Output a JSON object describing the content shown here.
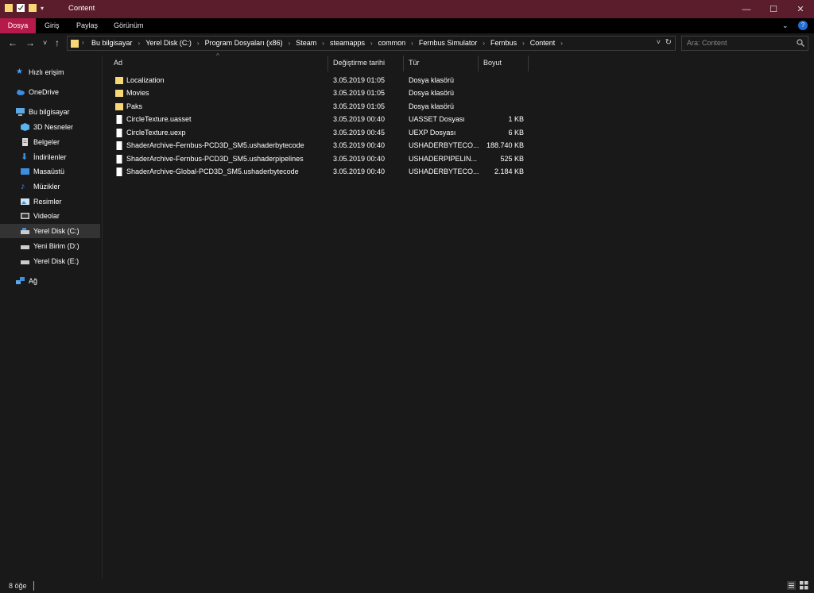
{
  "window": {
    "title": "Content",
    "controls": {
      "minimize": "—",
      "maximize": "☐",
      "close": "✕"
    }
  },
  "ribbon": {
    "tabs": [
      "Dosya",
      "Giriş",
      "Paylaş",
      "Görünüm"
    ],
    "help": "?"
  },
  "nav": {
    "back": "←",
    "forward": "→",
    "recent": "˅",
    "up": "↑",
    "refresh": "↻",
    "dropdown": "˅"
  },
  "breadcrumbs": [
    "Bu bilgisayar",
    "Yerel Disk (C:)",
    "Program Dosyaları (x86)",
    "Steam",
    "steamapps",
    "common",
    "Fernbus Simulator",
    "Fernbus",
    "Content"
  ],
  "search": {
    "placeholder": "Ara: Content"
  },
  "sidebar": {
    "items": [
      {
        "label": "Hızlı erişim",
        "icon": "star-icon"
      },
      {
        "label": "OneDrive",
        "icon": "cloud-icon"
      },
      {
        "label": "Bu bilgisayar",
        "icon": "computer-icon"
      },
      {
        "label": "3D Nesneler",
        "icon": "cube-icon"
      },
      {
        "label": "Belgeler",
        "icon": "document-icon"
      },
      {
        "label": "İndirilenler",
        "icon": "download-icon"
      },
      {
        "label": "Masaüstü",
        "icon": "desktop-icon"
      },
      {
        "label": "Müzikler",
        "icon": "music-icon"
      },
      {
        "label": "Resimler",
        "icon": "pictures-icon"
      },
      {
        "label": "Videolar",
        "icon": "video-icon"
      },
      {
        "label": "Yerel Disk (C:)",
        "icon": "drive-icon",
        "selected": true
      },
      {
        "label": "Yeni Birim (D:)",
        "icon": "drive-icon"
      },
      {
        "label": "Yerel Disk (E:)",
        "icon": "drive-icon"
      },
      {
        "label": "Ağ",
        "icon": "network-icon"
      }
    ]
  },
  "columns": {
    "name": "Ad",
    "modified": "Değiştirme tarihi",
    "type": "Tür",
    "size": "Boyut"
  },
  "files": [
    {
      "name": "Localization",
      "modified": "3.05.2019 01:05",
      "type": "Dosya klasörü",
      "size": "",
      "icon": "folder-icon"
    },
    {
      "name": "Movies",
      "modified": "3.05.2019 01:05",
      "type": "Dosya klasörü",
      "size": "",
      "icon": "folder-icon"
    },
    {
      "name": "Paks",
      "modified": "3.05.2019 01:05",
      "type": "Dosya klasörü",
      "size": "",
      "icon": "folder-icon"
    },
    {
      "name": "CircleTexture.uasset",
      "modified": "3.05.2019 00:40",
      "type": "UASSET Dosyası",
      "size": "1 KB",
      "icon": "file-icon"
    },
    {
      "name": "CircleTexture.uexp",
      "modified": "3.05.2019 00:45",
      "type": "UEXP Dosyası",
      "size": "6 KB",
      "icon": "file-icon"
    },
    {
      "name": "ShaderArchive-Fernbus-PCD3D_SM5.ushaderbytecode",
      "modified": "3.05.2019 00:40",
      "type": "USHADERBYTECO...",
      "size": "188.740 KB",
      "icon": "file-icon"
    },
    {
      "name": "ShaderArchive-Fernbus-PCD3D_SM5.ushaderpipelines",
      "modified": "3.05.2019 00:40",
      "type": "USHADERPIPELIN...",
      "size": "525 KB",
      "icon": "file-icon"
    },
    {
      "name": "ShaderArchive-Global-PCD3D_SM5.ushaderbytecode",
      "modified": "3.05.2019 00:40",
      "type": "USHADERBYTECO...",
      "size": "2.184 KB",
      "icon": "file-icon"
    }
  ],
  "status": {
    "count": "8 öğe"
  },
  "colors": {
    "titlebar": "#5b1d2c",
    "accent": "#b51a4a",
    "background": "#191919",
    "folder": "#f8d775"
  }
}
